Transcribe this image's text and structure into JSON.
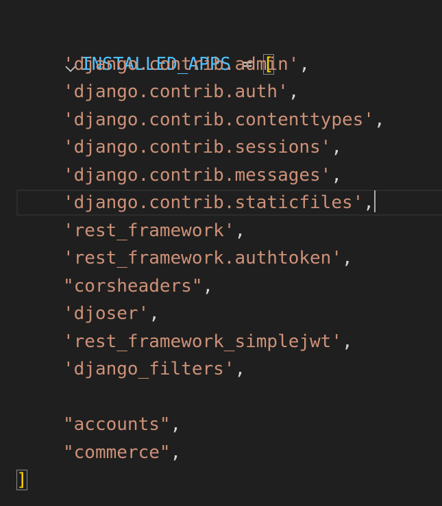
{
  "editor": {
    "fold_icon": "chevron-down-icon",
    "current_line_index": 6,
    "colors": {
      "background": "#1f1f1f",
      "variable": "#4fc1ff",
      "string": "#ce9178",
      "operator": "#d4d4d4",
      "bracket": "#ffd700"
    },
    "lines": [
      {
        "var": "INSTALLED_APPS",
        "op": " = ",
        "bracket": "["
      },
      {
        "str": "'django.contrib.admin'",
        "punct": ","
      },
      {
        "str": "'django.contrib.auth'",
        "punct": ","
      },
      {
        "str": "'django.contrib.contenttypes'",
        "punct": ","
      },
      {
        "str": "'django.contrib.sessions'",
        "punct": ","
      },
      {
        "str": "'django.contrib.messages'",
        "punct": ","
      },
      {
        "str": "'django.contrib.staticfiles'",
        "punct": ","
      },
      {
        "str": "'rest_framework'",
        "punct": ","
      },
      {
        "str": "'rest_framework.authtoken'",
        "punct": ","
      },
      {
        "str": "\"corsheaders\"",
        "punct": ","
      },
      {
        "str": "'djoser'",
        "punct": ","
      },
      {
        "str": "'rest_framework_simplejwt'",
        "punct": ","
      },
      {
        "str": "'django_filters'",
        "punct": ","
      },
      {
        "str": "",
        "punct": ""
      },
      {
        "str": "\"accounts\"",
        "punct": ","
      },
      {
        "str": "\"commerce\"",
        "punct": ","
      },
      {
        "bracket": "]"
      }
    ]
  }
}
